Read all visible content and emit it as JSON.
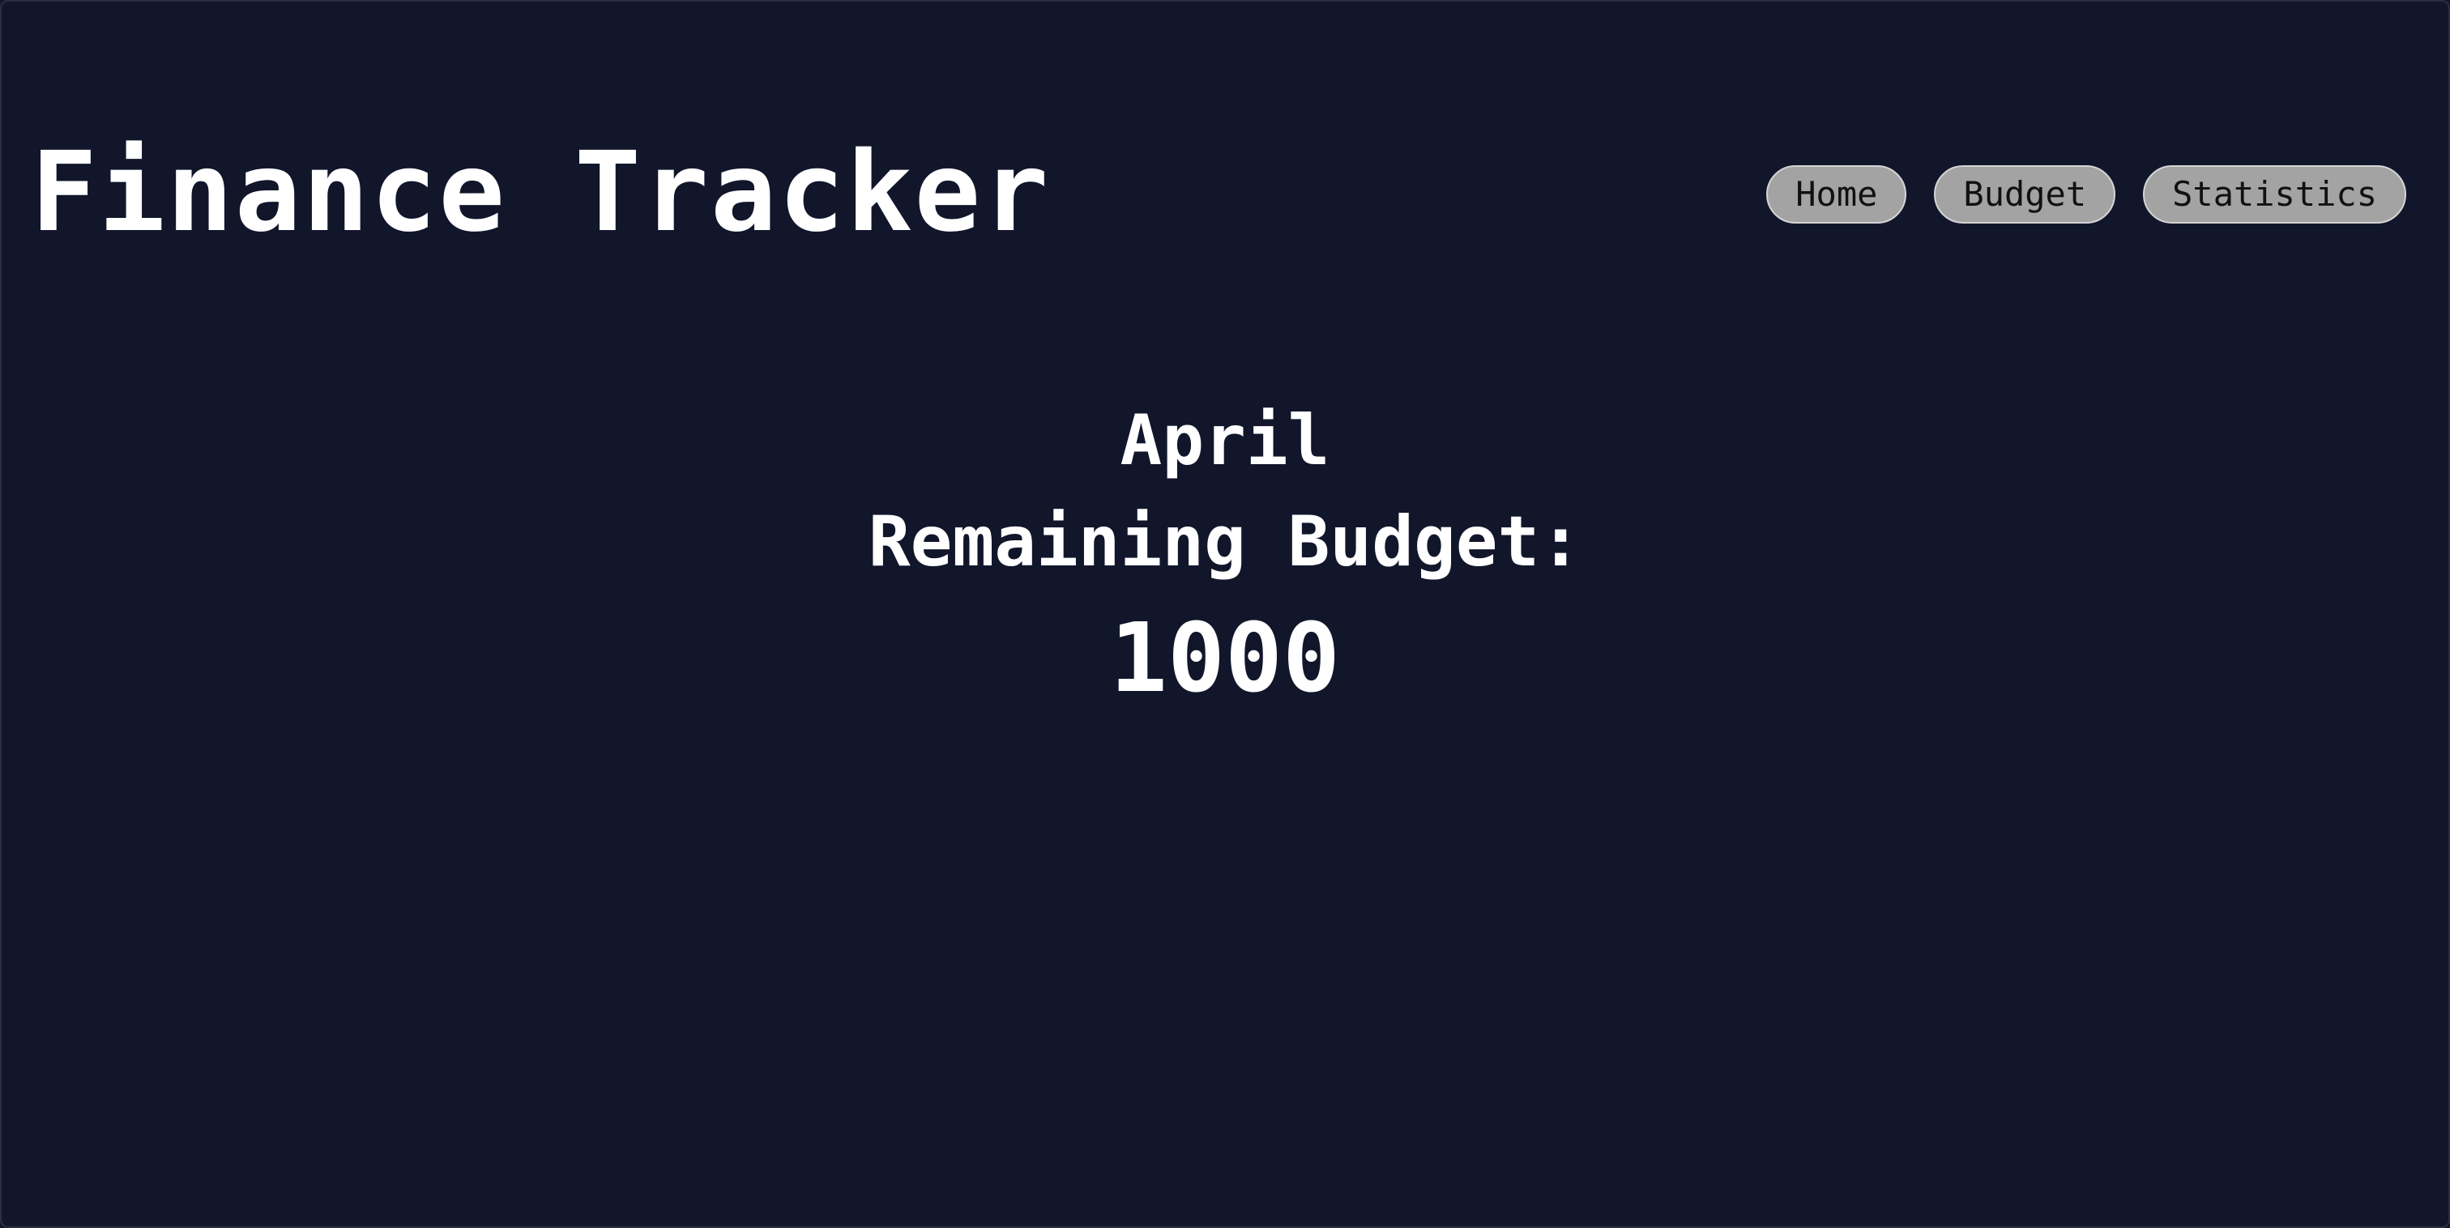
{
  "header": {
    "title": "Finance Tracker"
  },
  "nav": {
    "items": [
      {
        "label": "Home"
      },
      {
        "label": "Budget"
      },
      {
        "label": "Statistics"
      }
    ]
  },
  "summary": {
    "month": "April",
    "remaining_label": "Remaining Budget:",
    "amount": "1000"
  },
  "colors": {
    "background": "#11162b",
    "text": "#ffffff",
    "button_fill": "#a3a3a3",
    "button_border": "#d4d4d4",
    "button_text": "#111111"
  }
}
